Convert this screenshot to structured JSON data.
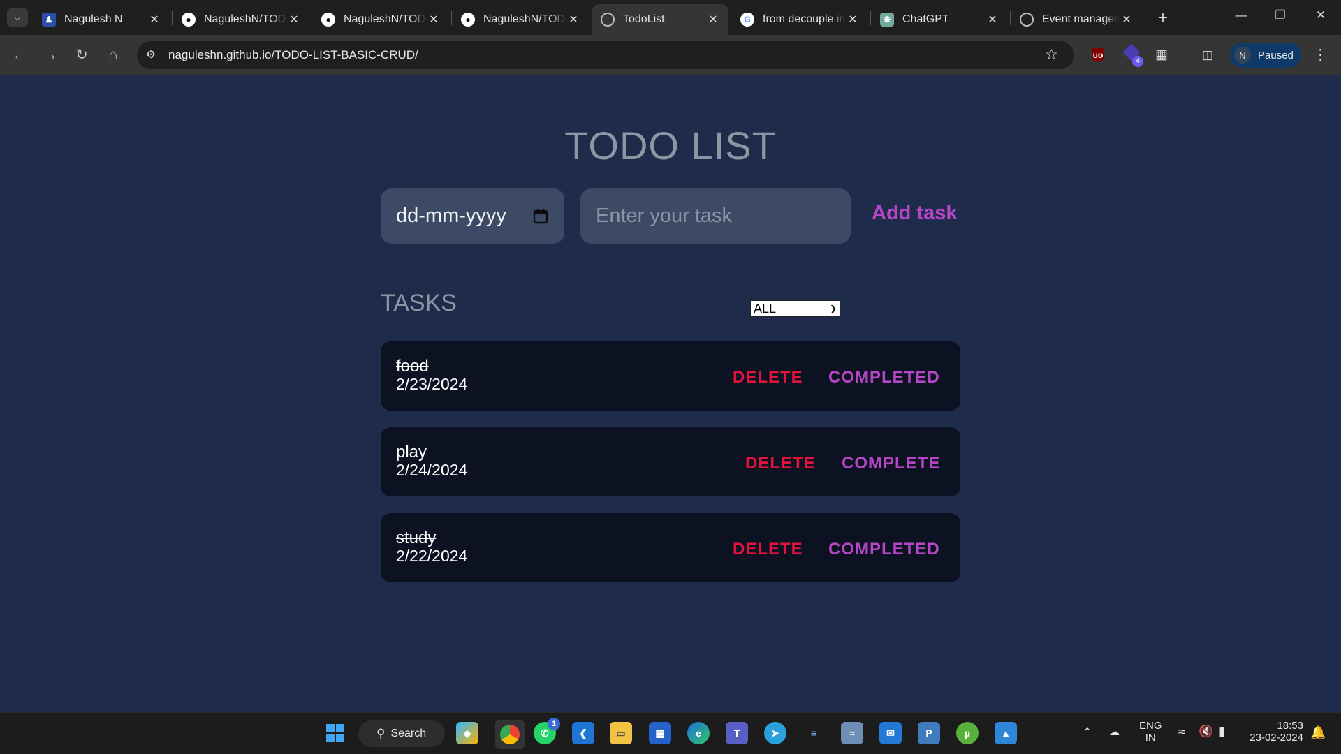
{
  "browser": {
    "tabs": [
      {
        "title": "Nagulesh N",
        "favicon": "avatar-photo",
        "active": false
      },
      {
        "title": "NaguleshN/TODO-LIST-BASIC-CRUD",
        "favicon": "github-icon",
        "active": false
      },
      {
        "title": "NaguleshN/TODO-LIST-BASIC-CRUD",
        "favicon": "github-icon",
        "active": false
      },
      {
        "title": "NaguleshN/TODO-LIST-BASIC-CRUD",
        "favicon": "github-icon",
        "active": false
      },
      {
        "title": "TodoList",
        "favicon": "globe-icon",
        "active": true
      },
      {
        "title": "from decouple import config",
        "favicon": "google-icon",
        "active": false
      },
      {
        "title": "ChatGPT",
        "favicon": "chatgpt-icon",
        "active": false
      },
      {
        "title": "Event management",
        "favicon": "globe-icon",
        "active": false
      }
    ],
    "url": "naguleshn.github.io/TODO-LIST-BASIC-CRUD/",
    "extension_badge": "4",
    "profile": {
      "initial": "N",
      "status": "Paused"
    }
  },
  "app": {
    "title": "TODO LIST",
    "date_placeholder": "dd-mm-yyyy",
    "task_placeholder": "Enter your task",
    "add_button": "Add task",
    "tasks_heading": "TASKS",
    "filter_value": "ALL",
    "delete_label": "DELETE",
    "tasks": [
      {
        "name": "food",
        "date": "2/23/2024",
        "done": true,
        "status_label": "COMPLETED"
      },
      {
        "name": "play",
        "date": "2/24/2024",
        "done": false,
        "status_label": "COMPLETE"
      },
      {
        "name": "study",
        "date": "2/22/2024",
        "done": true,
        "status_label": "COMPLETED"
      }
    ],
    "colors": {
      "background": "#1e2b4a",
      "card": "#0c1222",
      "delete": "#e3133e",
      "accent": "#b746c7"
    }
  },
  "taskbar": {
    "search_label": "Search",
    "whatsapp_badge": "1",
    "language": "ENG",
    "region": "IN",
    "time": "18:53",
    "date": "23-02-2024"
  }
}
